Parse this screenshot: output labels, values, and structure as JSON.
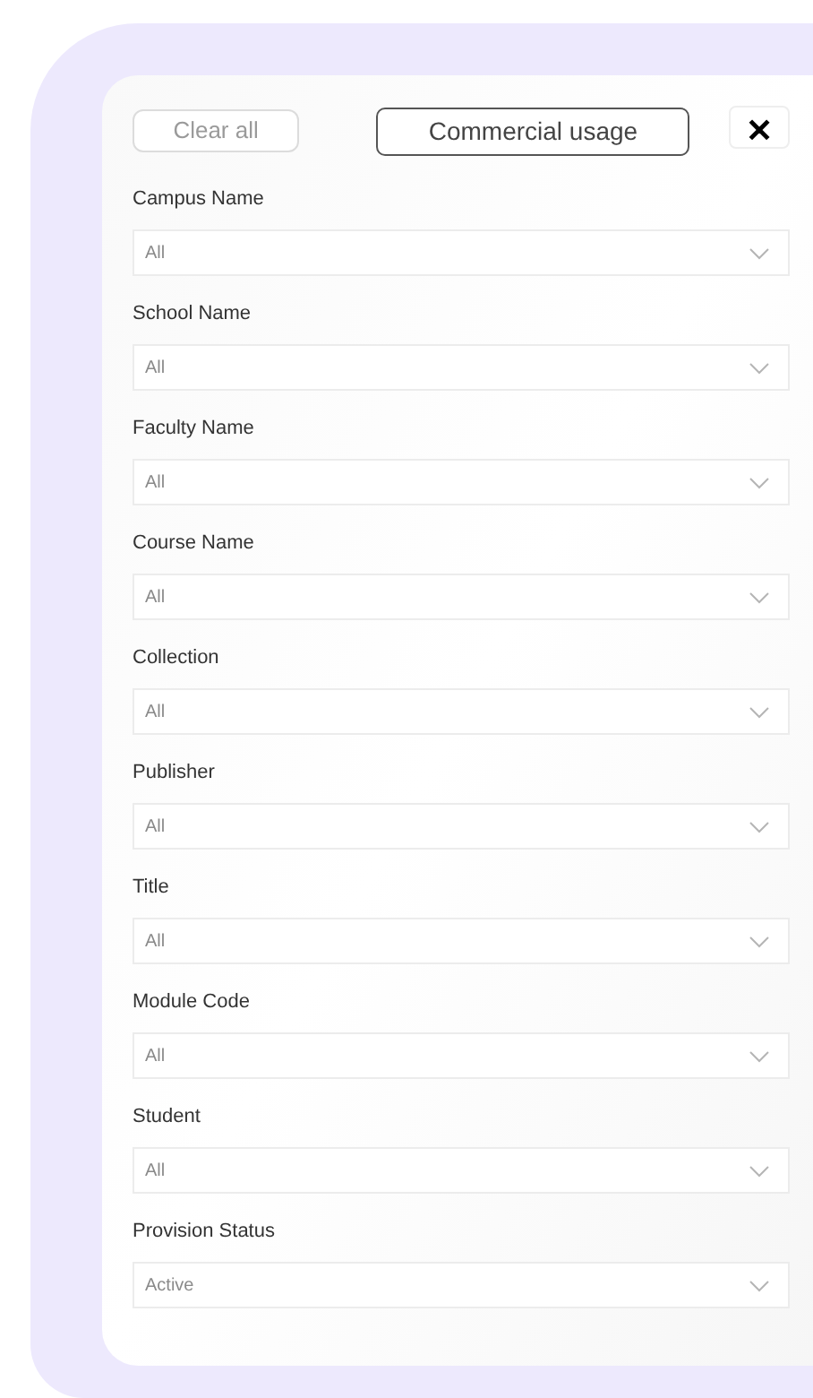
{
  "buttons": {
    "clear_all": {
      "label": "Clear all",
      "disabled": true
    },
    "commercial_usage": {
      "label": "Commercial usage"
    },
    "close": {
      "label": "✕"
    }
  },
  "filters": [
    {
      "label": "Campus Name",
      "value": "All"
    },
    {
      "label": "School Name",
      "value": "All"
    },
    {
      "label": "Faculty Name",
      "value": "All"
    },
    {
      "label": "Course Name",
      "value": "All"
    },
    {
      "label": "Collection",
      "value": "All"
    },
    {
      "label": "Publisher",
      "value": "All"
    },
    {
      "label": "Title",
      "value": "All"
    },
    {
      "label": "Module Code",
      "value": "All"
    },
    {
      "label": "Student",
      "value": "All"
    },
    {
      "label": "Provision Status",
      "value": "Active"
    }
  ]
}
